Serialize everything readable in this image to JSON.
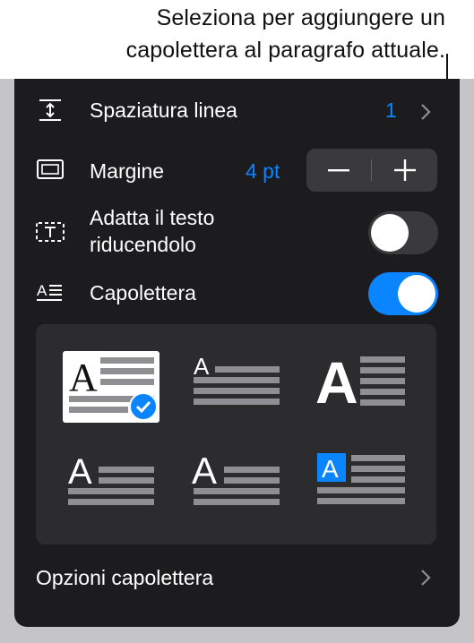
{
  "callout": {
    "line1": "Seleziona per aggiungere un",
    "line2": "capolettera al paragrafo attuale."
  },
  "spacing": {
    "label": "Spaziatura linea",
    "value": "1",
    "icon": "line-spacing-icon"
  },
  "margin": {
    "label": "Margine",
    "value": "4 pt",
    "decrement_icon": "minus-icon",
    "increment_icon": "plus-icon"
  },
  "shrink": {
    "label_line1": "Adatta il testo",
    "label_line2": "riducendolo",
    "enabled": false
  },
  "dropcap": {
    "label": "Capolettera",
    "enabled": true
  },
  "styles": [
    {
      "glyph": "A",
      "selected": true
    },
    {
      "glyph": "A",
      "selected": false
    },
    {
      "glyph": "A",
      "selected": false
    },
    {
      "glyph": "A",
      "selected": false
    },
    {
      "glyph": "A",
      "selected": false
    },
    {
      "glyph": "A",
      "selected": false
    }
  ],
  "options": {
    "label": "Opzioni capolettera"
  },
  "colors": {
    "accent": "#0a84ff",
    "panel": "#1c1c1e",
    "control": "#3a3a3c",
    "toggle_on": "#0a84ff",
    "toggle_off": "#3a3a3c"
  }
}
